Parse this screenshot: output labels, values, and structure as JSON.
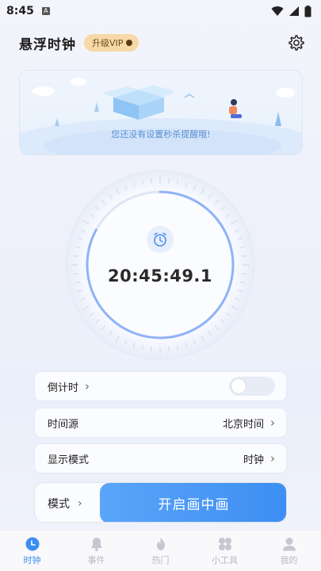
{
  "status_bar": {
    "time": "8:45",
    "badge": "A"
  },
  "header": {
    "title": "悬浮时钟",
    "vip_label": "升级VIP"
  },
  "banner": {
    "hint": "您还没有设置秒杀提醒哦!"
  },
  "clock": {
    "time": "20:45:49.1",
    "progress": 0.83
  },
  "settings": {
    "countdown": {
      "label": "倒计时",
      "enabled": false
    },
    "time_source": {
      "label": "时间源",
      "value": "北京时间"
    },
    "display_mode": {
      "label": "显示模式",
      "value": "时钟"
    }
  },
  "action": {
    "mode_label": "模式",
    "start_label": "开启画中画"
  },
  "tabs": [
    {
      "label": "时钟",
      "icon": "clock-icon",
      "active": true
    },
    {
      "label": "事件",
      "icon": "bell-icon",
      "active": false
    },
    {
      "label": "热门",
      "icon": "flame-icon",
      "active": false
    },
    {
      "label": "小工具",
      "icon": "grid-icon",
      "active": false
    },
    {
      "label": "我的",
      "icon": "user-icon",
      "active": false
    }
  ],
  "colors": {
    "accent": "#3d8ef3",
    "vip_bg": "#f6d9a7",
    "inactive": "#b7bac3"
  }
}
